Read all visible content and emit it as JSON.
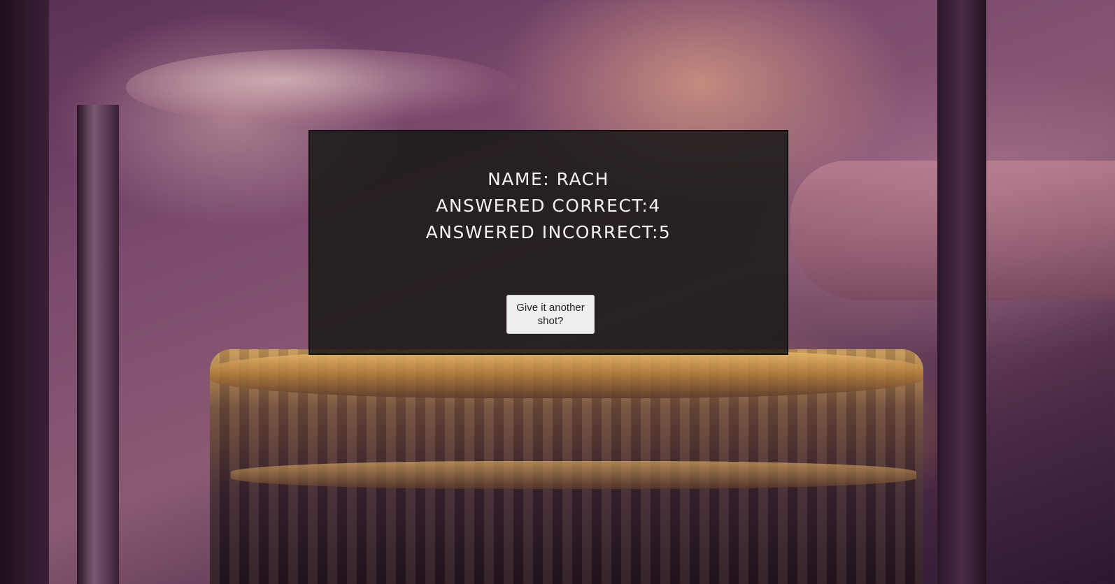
{
  "results": {
    "name_label": "NAME: RACH",
    "correct_label": "ANSWERED CORRECT:4",
    "incorrect_label": "ANSWERED INCORRECT:5"
  },
  "actions": {
    "retry_label": "Give it another shot?"
  },
  "colors": {
    "panel_background": "#181816",
    "text": "#f2f2f2",
    "button_background": "#efefef"
  }
}
